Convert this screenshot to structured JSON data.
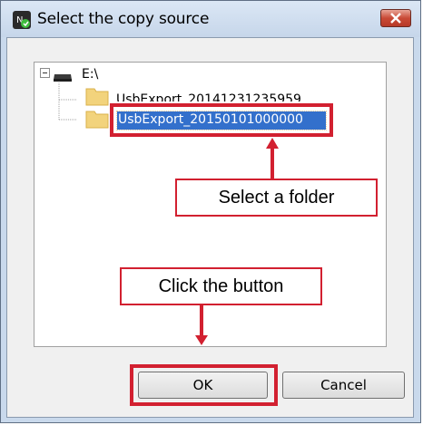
{
  "window": {
    "title": "Select the copy source"
  },
  "tree": {
    "drive_label": "E:\\",
    "folders": [
      {
        "label": "UsbExport_20141231235959",
        "selected": false
      },
      {
        "label": "UsbExport_20150101000000",
        "selected": true
      }
    ]
  },
  "annotations": {
    "select_folder": "Select a folder",
    "click_button": "Click the button"
  },
  "buttons": {
    "ok": "OK",
    "cancel": "Cancel"
  },
  "colors": {
    "highlight_red": "#d22030",
    "selection_blue": "#3370cc",
    "dialog_frame": "#c9d9ec"
  }
}
